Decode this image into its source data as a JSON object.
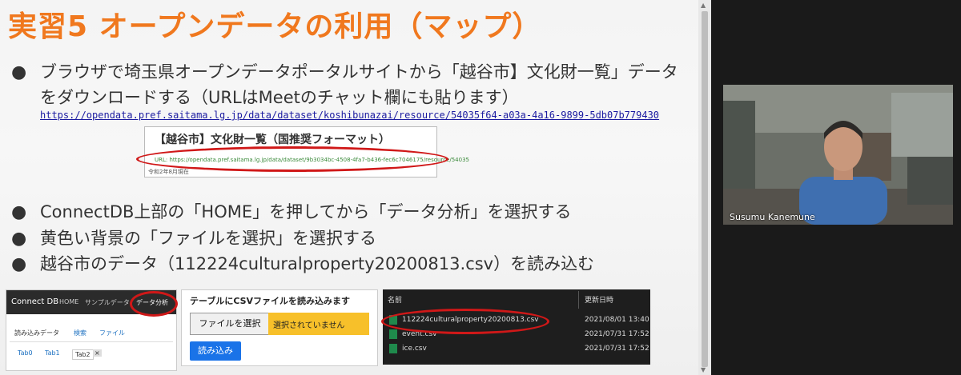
{
  "slide": {
    "title": "実習5 オープンデータの利用（マップ）",
    "bullets": [
      {
        "line1": "ブラウザで埼玉県オープンデータポータルサイトから「越谷市】文化財一覧」データ",
        "line2": "をダウンロードする（URLはMeetのチャット欄にも貼ります）"
      },
      {
        "line1": "ConnectDB上部の「HOME」を押してから「データ分析」を選択する"
      },
      {
        "line1": "黄色い背景の「ファイルを選択」を選択する"
      },
      {
        "line1": "越谷市のデータ（112224culturalproperty20200813.csv）を読み込む"
      }
    ],
    "url": "https://opendata.pref.saitama.lg.jp/data/dataset/koshibunazai/resource/54035f64-a03a-4a16-9899-5db07b779430",
    "portal": {
      "title": "【越谷市】文化財一覧（国推奨フォーマット）",
      "link": "URL: https://opendata.pref.saitama.lg.jp/data/dataset/9b3034bc-4508-4fa7-b436-fec6c7046175/resource/54035",
      "date": "令和2年8月現在"
    }
  },
  "connectdb": {
    "brand": "Connect DB",
    "nav": [
      "HOME",
      "サンプルデータ",
      "データ分析"
    ],
    "tabs_row1": [
      "読み込みデータ",
      "検索",
      "ファイル"
    ],
    "tabs_row2": [
      "Tab0",
      "Tab1",
      "Tab2"
    ],
    "close": "×"
  },
  "csv_loader": {
    "title": "テーブルにCSVファイルを読み込みます",
    "file_button": "ファイルを選択",
    "file_status": "選択されていません",
    "load_button": "読み込み"
  },
  "explorer": {
    "col_name": "名前",
    "col_date": "更新日時",
    "files": [
      {
        "name": "112224culturalproperty20200813.csv",
        "date": "2021/08/01 13:40"
      },
      {
        "name": "event.csv",
        "date": "2021/07/31 17:52"
      },
      {
        "name": "ice.csv",
        "date": "2021/07/31 17:52"
      }
    ]
  },
  "video": {
    "participant": "Susumu Kanemune"
  },
  "colors": {
    "title": "#f0781e",
    "highlight": "#d01818",
    "file_area": "#f7c02a",
    "load_button": "#1a73e8"
  }
}
